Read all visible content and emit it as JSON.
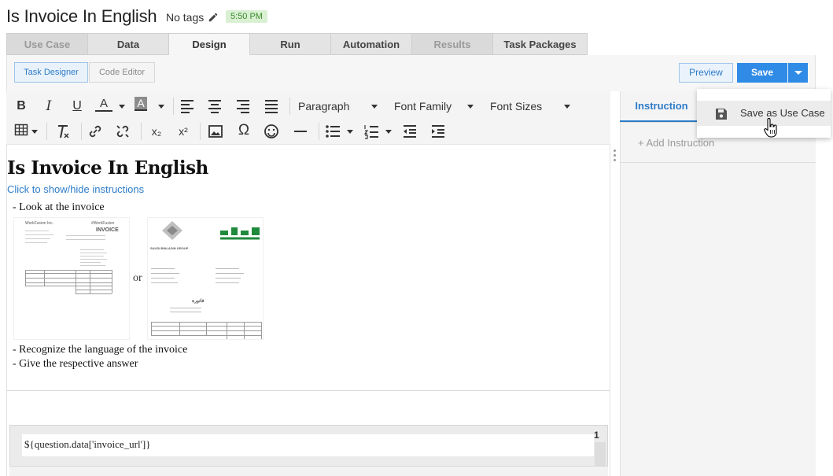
{
  "header": {
    "title": "Is Invoice In English",
    "tags": "No tags",
    "time_badge": "5:50 PM"
  },
  "tabs": [
    {
      "label": "Use Case",
      "state": "disabled"
    },
    {
      "label": "Data",
      "state": "normal"
    },
    {
      "label": "Design",
      "state": "active"
    },
    {
      "label": "Run",
      "state": "normal"
    },
    {
      "label": "Automation",
      "state": "normal"
    },
    {
      "label": "Results",
      "state": "disabled"
    },
    {
      "label": "Task Packages",
      "state": "normal"
    }
  ],
  "subbar": {
    "task_designer": "Task Designer",
    "code_editor": "Code Editor",
    "preview": "Preview",
    "save": "Save"
  },
  "toolbar": {
    "bold": "B",
    "italic": "I",
    "underline": "U",
    "font_color": "A",
    "bg_color": "A",
    "paragraph": "Paragraph",
    "font_family": "Font Family",
    "font_sizes": "Font Sizes",
    "omega": "Ω",
    "subscript": "x₂",
    "superscript": "x²"
  },
  "document": {
    "heading": "Is Invoice In English",
    "toggle_link": "Click to show/hide instructions",
    "step1": "- Look at the invoice",
    "or": "or",
    "step2": "- Recognize the language of the invoice",
    "step3": "- Give the respective answer",
    "invoice_en": {
      "company": "WorkFusion Inc.",
      "brand": "#WorkFusion",
      "doc_title": "INVOICE"
    },
    "invoice_ar": {
      "company_en": "SAUDI BINLADIN GROUP",
      "doc_title": "فاتورة"
    }
  },
  "question": {
    "number": "1",
    "template": "${question.data['invoice_url']}"
  },
  "right_panel": {
    "tab_label": "Instruction",
    "add_instruction": "+ Add Instruction"
  },
  "save_menu": {
    "save_as_use_case": "Save as Use Case"
  },
  "colors": {
    "accent": "#2d7cc9",
    "save_button": "#2f8be6",
    "time_badge_bg": "#d9f0d2",
    "arabic_logo": "#1f8a3c"
  }
}
